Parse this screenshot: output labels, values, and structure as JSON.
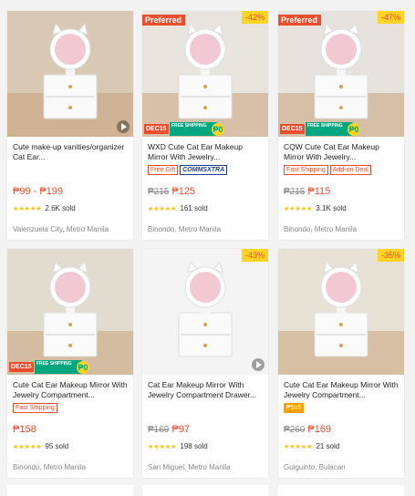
{
  "products": [
    {
      "title": "Cute make-up vanities/organizer Cat Ear...",
      "preferred": "",
      "discount": "",
      "old_price": "",
      "price": "₱99 - ₱199",
      "labels": [],
      "stars": "★★★★★",
      "sold": "2.6K sold",
      "location": "Valenzuela City, Metro Manila",
      "video": true,
      "banner": false
    },
    {
      "title": "WXD Cute Cat Ear Makeup Mirror With Jewelry...",
      "preferred": "Preferred",
      "discount": "-42%",
      "old_price": "₱215",
      "price": "₱125",
      "labels": [
        {
          "text": "Free Gift",
          "kind": "red"
        },
        {
          "text": "COMMSXTRA",
          "kind": "cx"
        }
      ],
      "stars": "★★★★★",
      "sold": "161 sold",
      "location": "Binondo, Metro Manila",
      "video": false,
      "banner": true
    },
    {
      "title": "CQW Cute Cat Ear Makeup Mirror With Jewelry...",
      "preferred": "Preferred",
      "discount": "-47%",
      "old_price": "₱215",
      "price": "₱115",
      "labels": [
        {
          "text": "Fast Shipping",
          "kind": "red"
        },
        {
          "text": "Add-on Deal",
          "kind": "red"
        }
      ],
      "stars": "★★★★★",
      "sold": "3.1K sold",
      "location": "Binondo, Metro Manila",
      "video": false,
      "banner": true
    },
    {
      "title": "Cute Cat Ear Makeup Mirror With Jewelry Compartment...",
      "preferred": "",
      "discount": "",
      "old_price": "",
      "price": "₱158",
      "labels": [
        {
          "text": "Fast Shipping",
          "kind": "red"
        }
      ],
      "stars": "★★★★★",
      "sold": "95 sold",
      "location": "Binondo, Metro Manila",
      "video": false,
      "banner": true
    },
    {
      "title": "Cat Ear Makeup Mirror With Jewelry Compartment Drawer...",
      "preferred": "",
      "discount": "-43%",
      "old_price": "₱169",
      "price": "₱97",
      "labels": [],
      "stars": "★★★★★",
      "sold": "198 sold",
      "location": "San Miguel, Metro Manila",
      "video": true,
      "banner": false
    },
    {
      "title": "Cute Cat Ear Makeup Mirror With Jewelry Compartment...",
      "preferred": "",
      "discount": "-35%",
      "old_price": "₱260",
      "price": "₱169",
      "labels": [
        {
          "text": "₱5off",
          "kind": "off"
        }
      ],
      "stars": "★★★★★",
      "sold": "21 sold",
      "location": "Guiguinto, Bulacan",
      "video": false,
      "banner": false
    }
  ],
  "banner": {
    "dec": "DEC15",
    "ship": "FREE SHIPPING",
    "min": "₱0"
  },
  "colors": {
    "brand": "#ee4d2d",
    "star": "#ffc107",
    "discount_bg": "#ffd424"
  }
}
